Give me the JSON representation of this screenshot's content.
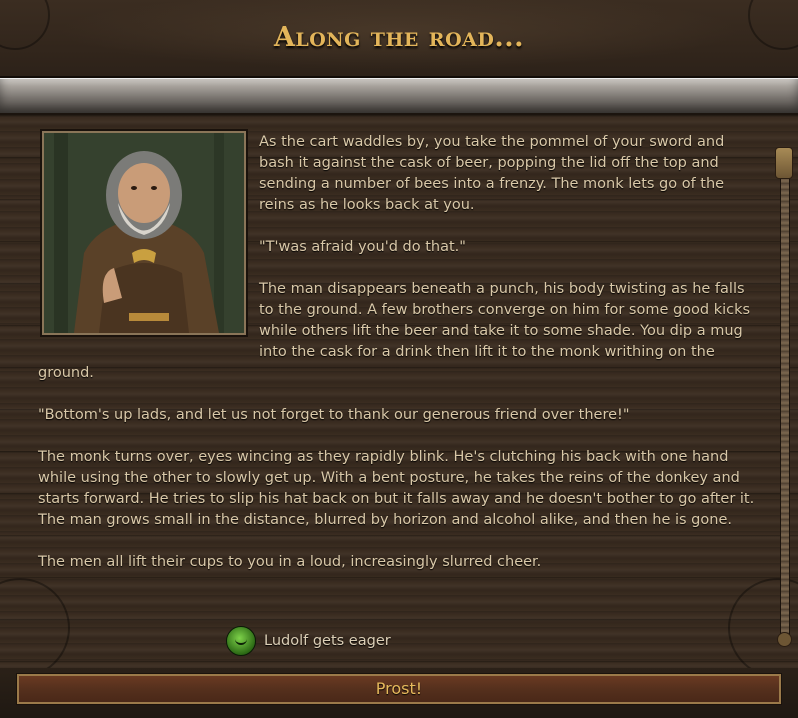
{
  "event": {
    "title": "Along the road...",
    "paragraphs": [
      "As the cart waddles by, you take the pommel of your sword and bash it against the cask of beer, popping the lid off the top and sending a number of bees into a frenzy. The monk lets go of the reins as he looks back at you.",
      "\"T'was afraid you'd do that.\"",
      "The man disappears beneath a punch, his body twisting as he falls to the ground. A few brothers converge on him for some good kicks while others lift the beer and take it to some shade. You dip a mug into the cask for a drink then lift it to the monk writhing on the ground.",
      "\"Bottom's up lads, and let us not forget to thank our generous friend over there!\"",
      "The monk turns over, eyes wincing as they rapidly blink. He's clutching his back with one hand while using the other to slowly get up. With a bent posture, he takes the reins of the donkey and starts forward. He tries to slip his hat back on but it falls away and he doesn't bother to go after it. The man grows small in the distance, blurred by horizon and alcohol alike, and then he is gone.",
      "The men all lift their cups to you in a loud, increasingly slurred cheer."
    ],
    "portrait_icon": "monk-portrait",
    "effect": {
      "icon": "smiling-face-icon",
      "label": "Ludolf gets eager",
      "color": "#4faa2a"
    },
    "action_button": {
      "label": "Prost!"
    }
  },
  "colors": {
    "title": "#e3b55a",
    "body_text": "#d9c8a8",
    "button_bg": "#55301d",
    "button_text": "#e6b95c"
  }
}
